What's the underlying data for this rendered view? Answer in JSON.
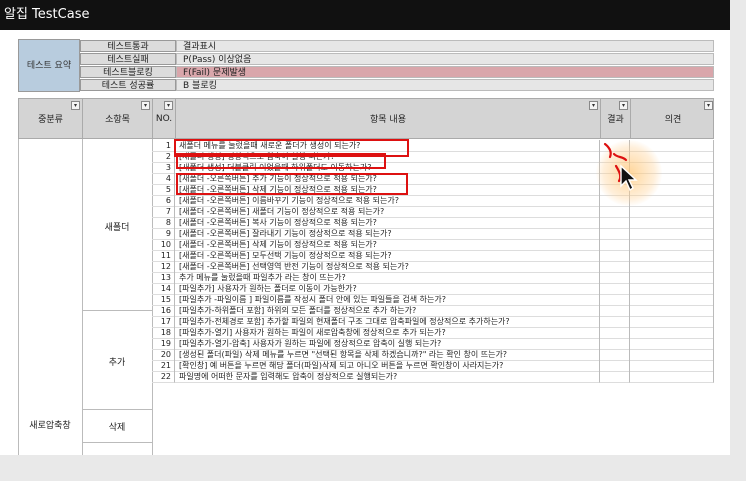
{
  "window": {
    "title": "알집 TestCase"
  },
  "summary": {
    "label": "테스트 요약",
    "rows": [
      {
        "name": "테스트통과",
        "value": "결과표시"
      },
      {
        "name": "테스트실패",
        "value": "P(Pass) 이상없음"
      },
      {
        "name": "테스트블로킹",
        "value": "F(Fail) 문제발생"
      },
      {
        "name": "테스트 성공률",
        "value": "B 블로킹"
      }
    ]
  },
  "columns": {
    "major": "중분류",
    "minor": "소항목",
    "no": "NO.",
    "item": "항목 내용",
    "result": "결과",
    "opinion": "의견"
  },
  "groups": {
    "major": "새로압축창",
    "minor1": "새폴더",
    "minor2": "추가",
    "minor3": "삭제"
  },
  "rows": [
    {
      "no": "1",
      "item": "새폴더 메뉴를 눌렀을때 새로운 폴더가 생성이 되는가?"
    },
    {
      "no": "2",
      "item": "[새폴더 생성] 정상적으로 압축이 실행 되는가?"
    },
    {
      "no": "3",
      "item": "[새폴더 생성] 더블클릭 이었을때 하위폴더도 이동하는가?"
    },
    {
      "no": "4",
      "item": "[새폴더 -오른쪽버튼] 추가 기능이 정상적으로 적용 되는가?"
    },
    {
      "no": "5",
      "item": "[새폴더 -오른쪽버튼] 삭제 기능이 정상적으로 적용 되는가?"
    },
    {
      "no": "6",
      "item": "[새폴더 -오른쪽버튼] 이름바꾸기 기능이 정상적으로 적용 되는가?"
    },
    {
      "no": "7",
      "item": "[새폴더 -오른쪽버튼] 새폴더 기능이 정상적으로 적용 되는가?"
    },
    {
      "no": "8",
      "item": "[새폴더 -오른쪽버튼] 복사 기능이 정상적으로 적용 되는가?"
    },
    {
      "no": "9",
      "item": "[새폴더 -오른쪽버튼] 잘라내기 기능이 정상적으로 적용 되는가?"
    },
    {
      "no": "10",
      "item": "[새폴더 -오른쪽버튼] 삭제 기능이 정상적으로 적용 되는가?"
    },
    {
      "no": "11",
      "item": "[새폴더 -오른쪽버튼] 모두선택 기능이 정상적으로 적용 되는가?"
    },
    {
      "no": "12",
      "item": "[새폴더 -오른쪽버튼] 선택영역 반전 기능이 정상적으로 적용 되는가?"
    },
    {
      "no": "13",
      "item": "추가 메뉴를 눌렀을때 파일추가 라는 창이 뜨는가?"
    },
    {
      "no": "14",
      "item": "[파일추가] 사용자가 원하는 폴더로 이동이 가능한가?"
    },
    {
      "no": "15",
      "item": "[파일추가 -파일이름 ] 파일이름를 작성시 폴더 안에 있는 파일들을 검색 하는가?"
    },
    {
      "no": "16",
      "item": "[파일추가-하위폴더 포함] 하위의 모든 폴더를 정상적으로 추가 하는가?"
    },
    {
      "no": "17",
      "item": "[파일추가-전체경로 포함] 추가할 파일의 현재폴더 구조 그대로 압축파일에 정상적으로 추가하는가?"
    },
    {
      "no": "18",
      "item": "[파일추가-열기] 사용자가 원하는 파일이 새로압축창에 정상적으로 추가 되는가?"
    },
    {
      "no": "19",
      "item": "[파일추가-열기-압축] 사용자가 원하는 파일에 정상적으로 압축이 실행 되는가?"
    },
    {
      "no": "20",
      "item": "[생성된 폴더(파일) 삭제 메뉴를 누르면 \"선택된 항목을 삭제 하겠습니까?\" 라는 확인 창이 뜨는가?"
    },
    {
      "no": "21",
      "item": "[확인창] 예 버튼을 누르면 해당 폴더(파일)삭제 되고 아니오 버튼을 누르면 확인창이 사라지는가?"
    },
    {
      "no": "22",
      "item": "파일명에 어떠한 문자를 입력해도 압축이 정상적으로 실행되는가?"
    }
  ],
  "annotation": {
    "handwriting": "ㅎ"
  },
  "colors": {
    "annotation": "#dd1111",
    "summary_label_bg": "#b8ccde",
    "blocking_bg": "#d9a6ab"
  }
}
